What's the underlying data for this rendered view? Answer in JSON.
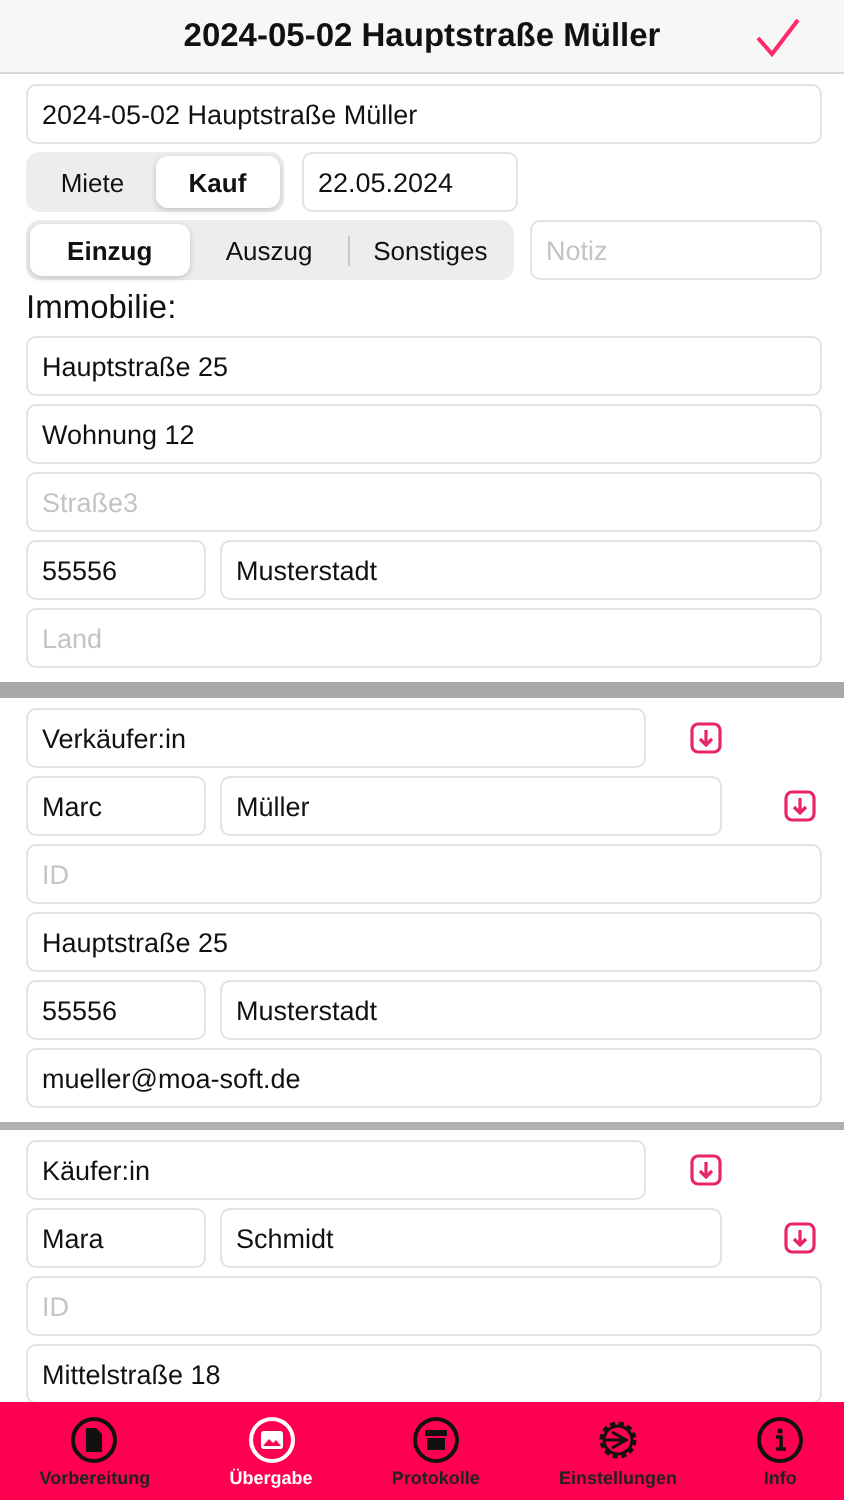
{
  "header": {
    "title": "2024-05-02 Hauptstraße Müller"
  },
  "name_field": {
    "value": "2024-05-02 Hauptstraße Müller"
  },
  "contract_type": [
    {
      "label": "Miete",
      "selected": false
    },
    {
      "label": "Kauf",
      "selected": true
    }
  ],
  "date_field": {
    "value": "22.05.2024"
  },
  "occasion": [
    {
      "label": "Einzug",
      "selected": true
    },
    {
      "label": "Auszug",
      "selected": false
    },
    {
      "label": "Sonstiges",
      "selected": false
    }
  ],
  "note_field": {
    "placeholder": "Notiz"
  },
  "property": {
    "heading": "Immobilie:",
    "street1": {
      "value": "Hauptstraße 25"
    },
    "street2": {
      "value": "Wohnung 12"
    },
    "street3": {
      "placeholder": "Straße3"
    },
    "zip": {
      "value": "55556"
    },
    "city": {
      "value": "Musterstadt"
    },
    "country": {
      "placeholder": "Land"
    }
  },
  "parties": [
    {
      "role": {
        "value": "Verkäufer:in"
      },
      "first_name": {
        "value": "Marc"
      },
      "last_name": {
        "value": "Müller"
      },
      "id": {
        "placeholder": "ID"
      },
      "street": {
        "value": "Hauptstraße 25"
      },
      "zip": {
        "value": "55556"
      },
      "city": {
        "value": "Musterstadt"
      },
      "email": {
        "value": "mueller@moa-soft.de"
      }
    },
    {
      "role": {
        "value": "Käufer:in"
      },
      "first_name": {
        "value": "Mara"
      },
      "last_name": {
        "value": "Schmidt"
      },
      "id": {
        "placeholder": "ID"
      },
      "street": {
        "value": "Mittelstraße 18"
      }
    }
  ],
  "tab_bar": [
    {
      "label": "Vorbereitung",
      "kind": "document",
      "selected": false
    },
    {
      "label": "Übergabe",
      "kind": "photo",
      "selected": true
    },
    {
      "label": "Protokolle",
      "kind": "archive",
      "selected": false
    },
    {
      "label": "Einstellungen",
      "kind": "gear",
      "selected": false
    },
    {
      "label": "Info",
      "kind": "info",
      "selected": false
    }
  ]
}
